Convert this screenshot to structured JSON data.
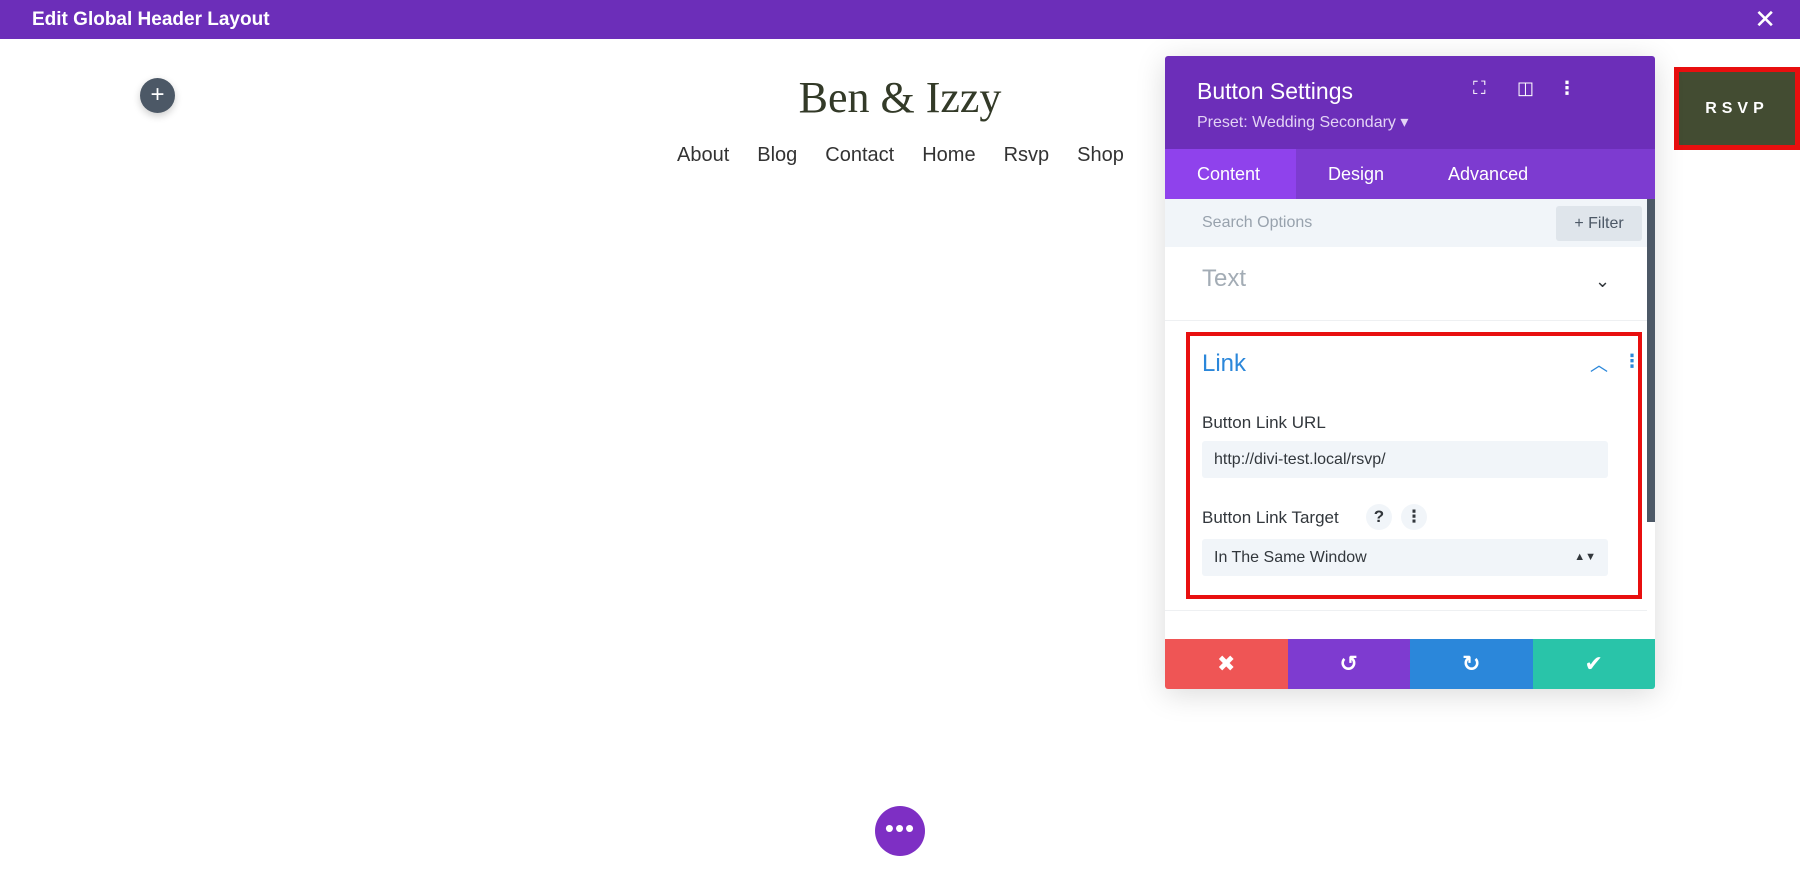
{
  "topbar": {
    "title": "Edit Global Header Layout",
    "close_icon": "close-icon"
  },
  "canvas": {
    "add_icon": "plus-icon",
    "site_title": "Ben & Izzy",
    "nav": [
      "About",
      "Blog",
      "Contact",
      "Home",
      "Rsvp",
      "Shop"
    ],
    "rsvp_button": "RSVP",
    "more_icon": "ellipsis-icon"
  },
  "modal": {
    "title": "Button Settings",
    "preset": "Preset: Wedding Secondary ▾",
    "icons": [
      "fullscreen-icon",
      "sidebar-icon",
      "more-vertical-icon"
    ],
    "tabs": [
      "Content",
      "Design",
      "Advanced"
    ],
    "active_tab": "Content",
    "search_placeholder": "Search Options",
    "filter_label": "+ Filter",
    "text_section": "Text",
    "link_section": {
      "title": "Link",
      "url_label": "Button Link URL",
      "url_value": "http://divi-test.local/rsvp/",
      "target_label": "Button Link Target",
      "help": "?",
      "target_value": "In The Same Window"
    },
    "footer": {
      "cancel": "✖",
      "undo": "↺",
      "redo": "↻",
      "save": "✔"
    }
  },
  "colors": {
    "brand": "#6c2eb9",
    "cancel": "#ef5555",
    "undo": "#7e3bd0",
    "redo": "#2b87da",
    "save": "#29c4a9",
    "highlight": "#e80f0f",
    "rsvp_bg": "#434c32"
  }
}
